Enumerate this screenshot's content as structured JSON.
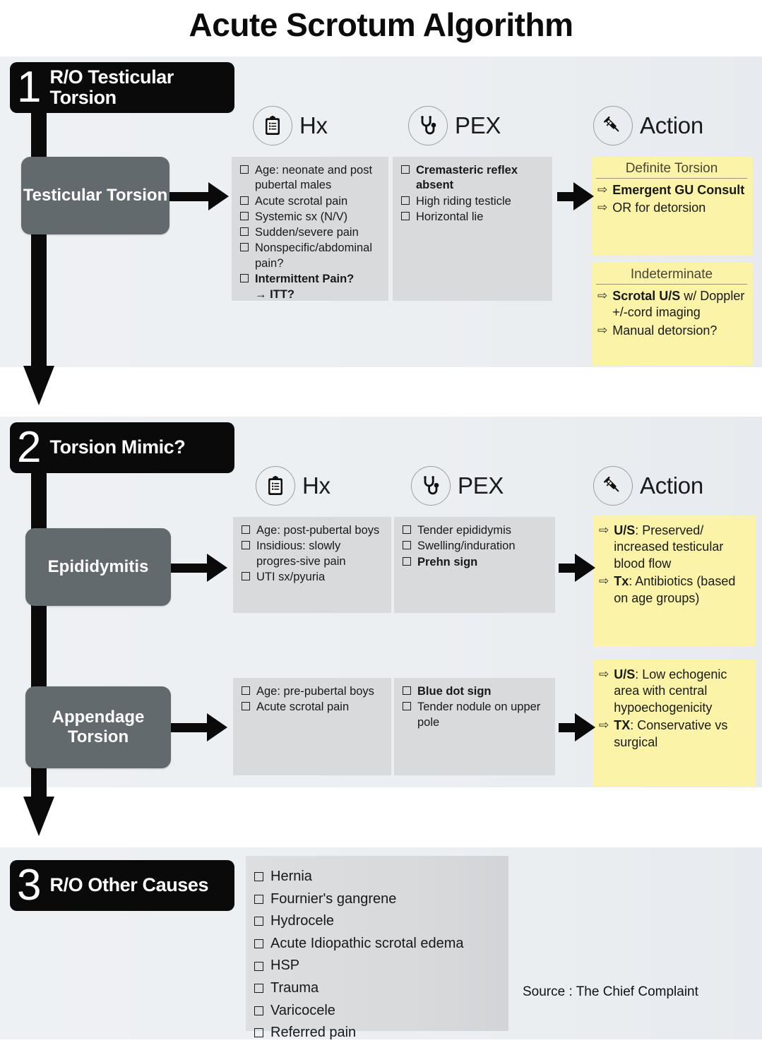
{
  "title": "Acute Scrotum Algorithm",
  "source": "Source : The Chief Complaint",
  "columns": {
    "hx": {
      "label": "Hx",
      "icon": "clipboard-icon"
    },
    "pex": {
      "label": "PEX",
      "icon": "stethoscope-icon"
    },
    "action": {
      "label": "Action",
      "icon": "syringe-icon"
    }
  },
  "colors": {
    "panel_bg": "#eceff2",
    "step_header_bg": "#0a0a0a",
    "condition_box_bg": "#636a6e",
    "fact_box_bg": "#d8dadc",
    "action_box_bg": "#fbf3a8",
    "arrow": "#0a0a0a"
  },
  "sections": [
    {
      "number": "1",
      "title": "R/O Testicular Torsion",
      "rows": [
        {
          "condition": "Testicular Torsion",
          "hx": [
            {
              "text": "Age: neonate and post pubertal males",
              "bold": false
            },
            {
              "text": "Acute scrotal pain",
              "bold": false
            },
            {
              "text": "Systemic sx (N/V)",
              "bold": false
            },
            {
              "text": "Sudden/severe pain",
              "bold": false
            },
            {
              "text": "Nonspecific/abdominal pain?",
              "bold": false
            },
            {
              "text": "Intermittent Pain?",
              "bold": true
            },
            {
              "text": "→ ITT?",
              "bold": true,
              "checkbox": false
            }
          ],
          "pex": [
            {
              "text": "Cremasteric reflex absent",
              "bold": true
            },
            {
              "text": "High riding testicle",
              "bold": false
            },
            {
              "text": "Horizontal lie",
              "bold": false
            }
          ],
          "action_groups": [
            {
              "heading": "Definite Torsion",
              "items": [
                {
                  "text": "Emergent GU Consult",
                  "bold": true
                },
                {
                  "text": "OR for detorsion",
                  "bold": false
                }
              ]
            },
            {
              "heading": "Indeterminate",
              "items": [
                {
                  "lead": "Scrotal U/S",
                  "text": " w/ Doppler +/-cord imaging",
                  "bold": false
                },
                {
                  "text": "Manual detorsion?",
                  "bold": false
                }
              ]
            }
          ]
        }
      ]
    },
    {
      "number": "2",
      "title": "Torsion Mimic?",
      "rows": [
        {
          "condition": "Epididymitis",
          "hx": [
            {
              "text": "Age: post-pubertal boys",
              "bold": false
            },
            {
              "text": "Insidious: slowly progres-sive pain",
              "bold": false
            },
            {
              "text": "UTI sx/pyuria",
              "bold": false
            }
          ],
          "pex": [
            {
              "text": "Tender epididymis",
              "bold": false
            },
            {
              "text": "Swelling/induration",
              "bold": false
            },
            {
              "text": "Prehn sign",
              "bold": true
            }
          ],
          "action_groups": [
            {
              "heading": "",
              "items": [
                {
                  "lead": "U/S",
                  "text": ": Preserved/ increased testicular blood flow",
                  "bold": false
                },
                {
                  "lead": "Tx",
                  "text": ": Antibiotics (based on age groups)",
                  "bold": false
                }
              ]
            }
          ]
        },
        {
          "condition": "Appendage Torsion",
          "hx": [
            {
              "text": "Age: pre-pubertal boys",
              "bold": false
            },
            {
              "text": "Acute scrotal pain",
              "bold": false
            }
          ],
          "pex": [
            {
              "text": "Blue dot sign",
              "bold": true
            },
            {
              "text": "Tender nodule on upper pole",
              "bold": false
            }
          ],
          "action_groups": [
            {
              "heading": "",
              "items": [
                {
                  "lead": "U/S",
                  "text": ": Low echogenic area with central hypoechogenicity",
                  "bold": false
                },
                {
                  "lead": "TX",
                  "text": ": Conservative vs surgical",
                  "bold": false
                }
              ]
            }
          ]
        }
      ]
    },
    {
      "number": "3",
      "title": "R/O Other Causes",
      "causes": [
        "Hernia",
        "Fournier's gangrene",
        "Hydrocele",
        "Acute Idiopathic scrotal edema",
        "HSP",
        "Trauma",
        "Varicocele",
        "Referred pain"
      ]
    }
  ]
}
